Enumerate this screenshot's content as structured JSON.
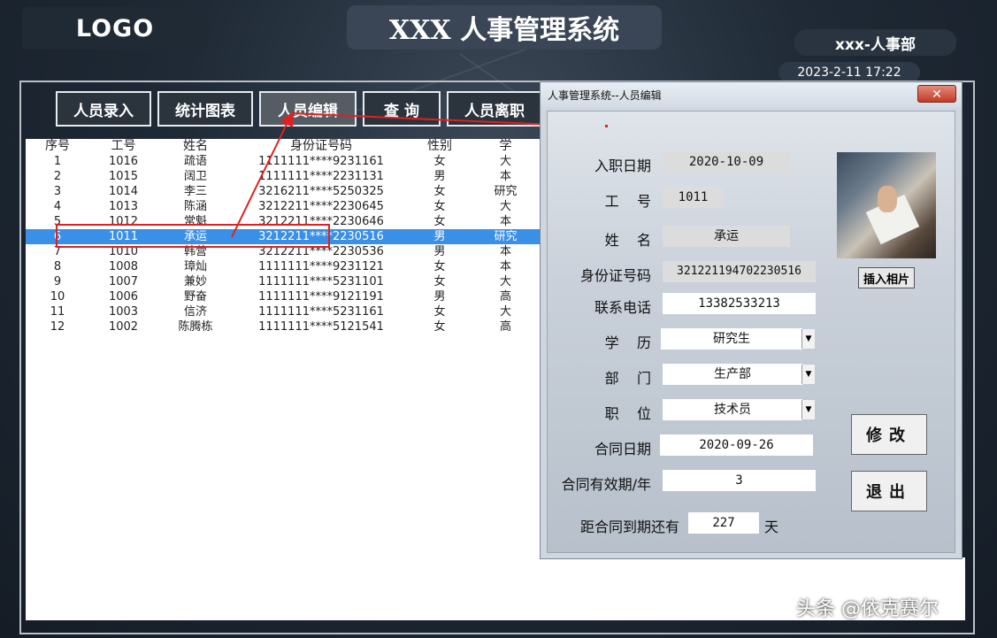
{
  "header": {
    "logo": "LOGO",
    "title": "XXX 人事管理系统",
    "department": "xxx-人事部",
    "datetime": "2023-2-11 17:22"
  },
  "nav": [
    {
      "label": "人员录入"
    },
    {
      "label": "统计图表"
    },
    {
      "label": "人员编辑"
    },
    {
      "label": "查  询"
    },
    {
      "label": "人员离职"
    }
  ],
  "table": {
    "columns": [
      "序号",
      "工号",
      "姓名",
      "身份证号码",
      "性别",
      "学"
    ],
    "rows": [
      [
        "1",
        "1016",
        "疏语",
        "1111111****9231161",
        "女",
        "大"
      ],
      [
        "2",
        "1015",
        "阔卫",
        "1111111****2231131",
        "男",
        "本"
      ],
      [
        "3",
        "1014",
        "李三",
        "3216211****5250325",
        "女",
        "研究"
      ],
      [
        "4",
        "1013",
        "陈涵",
        "3212211****2230645",
        "女",
        "大"
      ],
      [
        "5",
        "1012",
        "常魁",
        "3212211****2230646",
        "女",
        "本"
      ],
      [
        "6",
        "1011",
        "承运",
        "3212211****2230516",
        "男",
        "研究"
      ],
      [
        "7",
        "1010",
        "韩营",
        "3212211****2230536",
        "男",
        "本"
      ],
      [
        "8",
        "1008",
        "璋灿",
        "1111111****9231121",
        "女",
        "本"
      ],
      [
        "9",
        "1007",
        "兼妙",
        "1111111****5231101",
        "女",
        "大"
      ],
      [
        "10",
        "1006",
        "野奋",
        "1111111****9121191",
        "男",
        "高"
      ],
      [
        "11",
        "1003",
        "信济",
        "1111111****5231161",
        "女",
        "大"
      ],
      [
        "12",
        "1002",
        "陈腾栋",
        "1111111****5121541",
        "女",
        "高"
      ]
    ],
    "selected_index": 5
  },
  "dialog": {
    "title": "人事管理系统--人员编辑",
    "close_label": "✕",
    "fields": {
      "hire_date": {
        "label": "入职日期",
        "value": "2020-10-09"
      },
      "emp_no": {
        "label": "工    号",
        "value": "1011"
      },
      "name": {
        "label": "姓    名",
        "value": "承运"
      },
      "id_number": {
        "label": "身份证号码",
        "value": "321221194702230516"
      },
      "phone": {
        "label": "联系电话",
        "value": "13382533213"
      },
      "education": {
        "label": "学    历",
        "value": "研究生"
      },
      "department": {
        "label": "部    门",
        "value": "生产部"
      },
      "position": {
        "label": "职    位",
        "value": "技术员"
      },
      "contract_date": {
        "label": "合同日期",
        "value": "2020-09-26"
      },
      "contract_years": {
        "label": "合同有效期/年",
        "value": "3"
      },
      "days_left": {
        "label": "距合同到期还有",
        "value": "227",
        "unit": "天"
      }
    },
    "insert_photo_label": "插入相片",
    "modify_label": "修改",
    "exit_label": "退出"
  },
  "watermark": "头条 @依克赛尔",
  "colors": {
    "selection": "#3a8fe6",
    "highlight_red": "#e02020",
    "dialog_bg": "#cfd6de"
  }
}
